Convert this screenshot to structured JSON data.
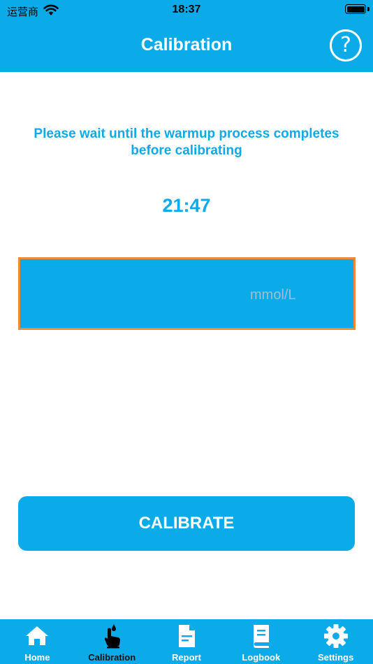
{
  "status_bar": {
    "carrier": "运营商",
    "time": "18:37"
  },
  "header": {
    "title": "Calibration",
    "help_icon": "question-circle-icon",
    "help_symbol": "?"
  },
  "main": {
    "warmup_message": "Please wait until the warmup process completes before calibrating",
    "countdown": "21:47",
    "glucose_input": {
      "value": "",
      "unit": "mmol/L"
    },
    "calibrate_label": "CALIBRATE"
  },
  "tabs": [
    {
      "label": "Home",
      "icon": "home-icon",
      "active": false
    },
    {
      "label": "Calibration",
      "icon": "finger-drop-icon",
      "active": true
    },
    {
      "label": "Report",
      "icon": "document-icon",
      "active": false
    },
    {
      "label": "Logbook",
      "icon": "book-icon",
      "active": false
    },
    {
      "label": "Settings",
      "icon": "gear-icon",
      "active": false
    }
  ],
  "colors": {
    "accent": "#0BABEA",
    "field_border": "#E98B3A",
    "active_tab": "#111111"
  }
}
